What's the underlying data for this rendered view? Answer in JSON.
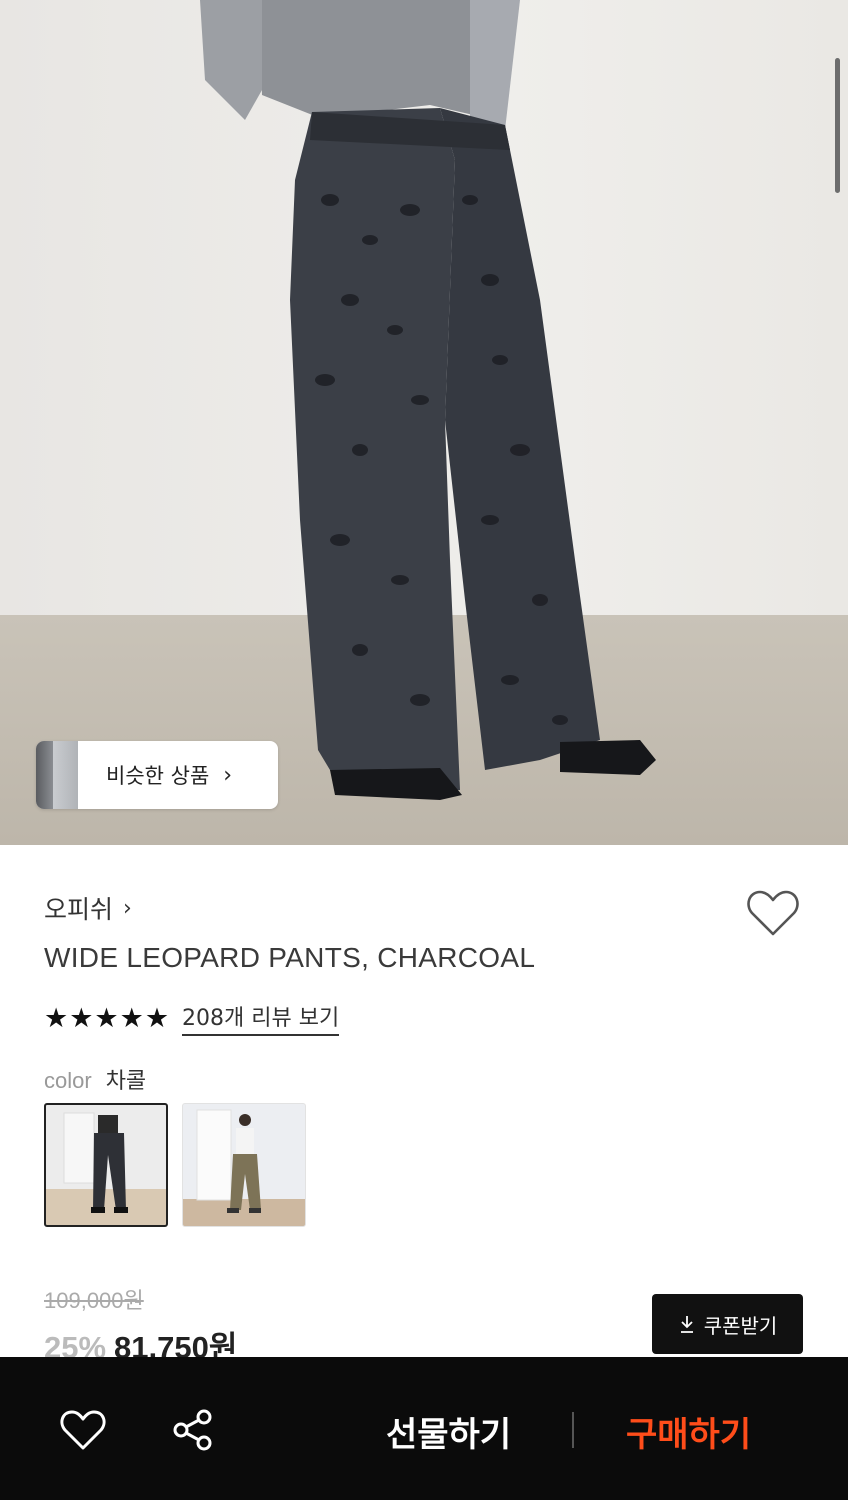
{
  "similar_products": {
    "label": "비슷한 상품",
    "chevron": "›"
  },
  "product": {
    "brand": "오피쉬",
    "brand_chevron": "›",
    "title": "WIDE LEOPARD PANTS, CHARCOAL",
    "stars": "★★★★★",
    "reviews_link": "208개 리뷰 보기",
    "color_label": "color",
    "color_value": "차콜",
    "original_price": "109,000원",
    "discount": "25%",
    "price": "81,750원"
  },
  "coupon": {
    "icon": "download-icon",
    "label": "쿠폰받기"
  },
  "bottom_bar": {
    "gift_label": "선물하기",
    "buy_label": "구매하기"
  },
  "colors": {
    "accent": "#ff4d1a",
    "bar_bg": "#0b0b0b"
  }
}
